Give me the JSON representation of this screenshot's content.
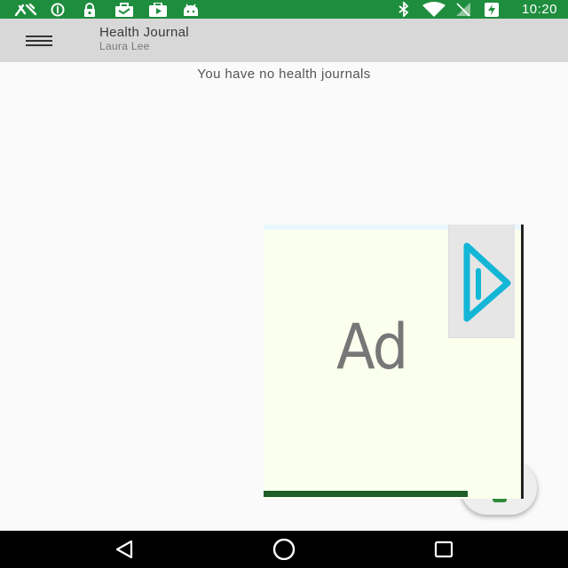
{
  "status_bar": {
    "time": "10:20",
    "background": "#1e8e3e",
    "left_icons": [
      "app-notification-icon",
      "info-icon",
      "lock-icon",
      "work-briefcase-icon",
      "youtube-icon",
      "android-icon"
    ],
    "right_icons": [
      "bluetooth-icon",
      "wifi-icon",
      "signal-off-icon",
      "battery-charging-icon"
    ]
  },
  "toolbar": {
    "title": "Health Journal",
    "subtitle": "Laura Lee",
    "menu_icon": "hamburger-menu-icon"
  },
  "content": {
    "empty_message": "You have no health journals"
  },
  "ad": {
    "label": "Ad",
    "play_icon": "play-icon"
  },
  "fab": {
    "icon": "add-icon"
  },
  "nav_bar": {
    "buttons": [
      "back-icon",
      "home-icon",
      "recents-icon"
    ]
  }
}
